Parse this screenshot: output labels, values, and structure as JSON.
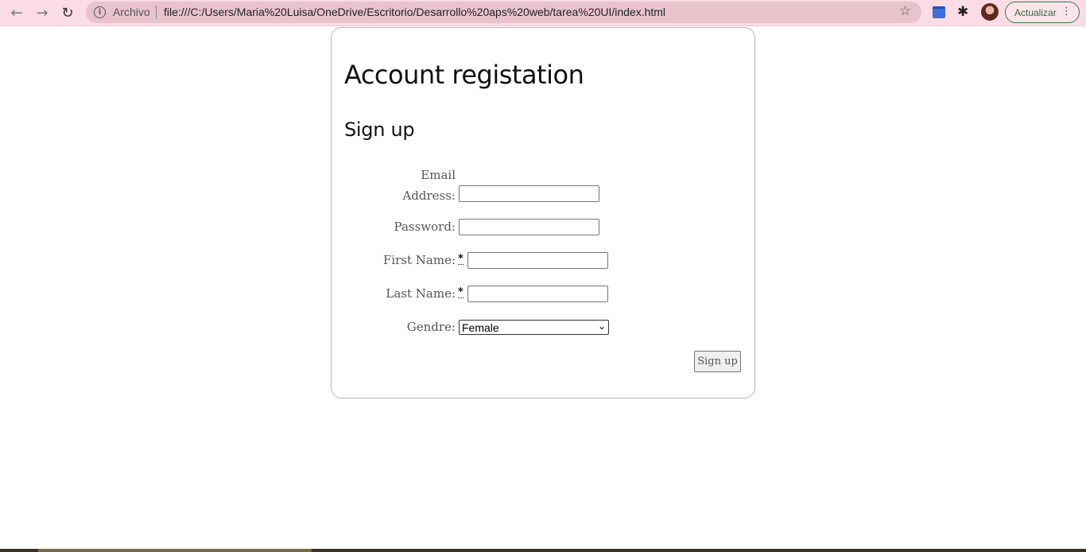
{
  "browser": {
    "back_icon": "←",
    "forward_icon": "→",
    "reload_icon": "↻",
    "site_info_label": "Archivo",
    "url": "file:///C:/Users/Maria%20Luisa/OneDrive/Escritorio/Desarrollo%20aps%20web/tarea%20UI/index.html",
    "bookmark_icon": "☆",
    "extensions_icon": "✱",
    "update_label": "Actualizar",
    "menu_icon": "⋮",
    "toolbar_color": "#fbdce4",
    "accent_green": "#2d6b3c"
  },
  "page": {
    "title": "Account registation",
    "subtitle": "Sign up",
    "form": {
      "email_label_line1": "Email",
      "email_label_line2": "Address:",
      "email_value": "",
      "password_label": "Password:",
      "password_value": "",
      "first_name_label": "First Name:",
      "first_name_required": "*",
      "first_name_value": "",
      "last_name_label": "Last Name:",
      "last_name_required": "*",
      "last_name_value": "",
      "gender_label": "Gendre:",
      "gender_selected": "Female",
      "submit_label": "Sign up"
    }
  }
}
